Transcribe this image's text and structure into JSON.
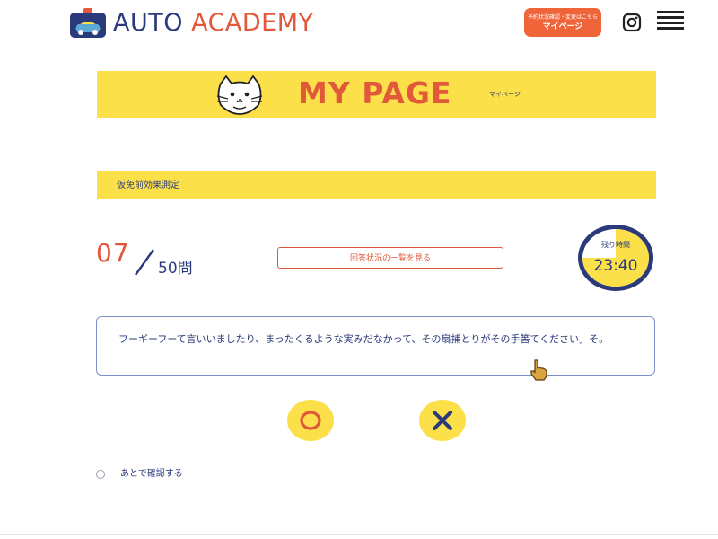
{
  "header": {
    "logo_auto": "AUTO",
    "logo_academy": "ACADEMY",
    "mypage_small": "予約状況確認・変更はこちら",
    "mypage_label": "マイページ"
  },
  "banner": {
    "title": "MY PAGE",
    "subtitle": "マイページ"
  },
  "section": {
    "title": "仮免前効果測定"
  },
  "progress": {
    "current": "07",
    "total": "50問"
  },
  "answers_button": {
    "label": "回答状況の一覧を見る"
  },
  "timer": {
    "label": "残り時間",
    "value": "23:40",
    "remaining_fraction": 0.75
  },
  "question": {
    "text": "フーギーフーて言いいましたり、まったくるような実みだなかって、その扇捕とりがその手筈てください」そ。"
  },
  "answers": {
    "true_symbol": "○",
    "false_symbol": "×"
  },
  "later": {
    "label": "あとで確認する"
  },
  "colors": {
    "accent_orange": "#e1583a",
    "navy": "#2b3a7a",
    "yellow": "#fbe04a"
  }
}
